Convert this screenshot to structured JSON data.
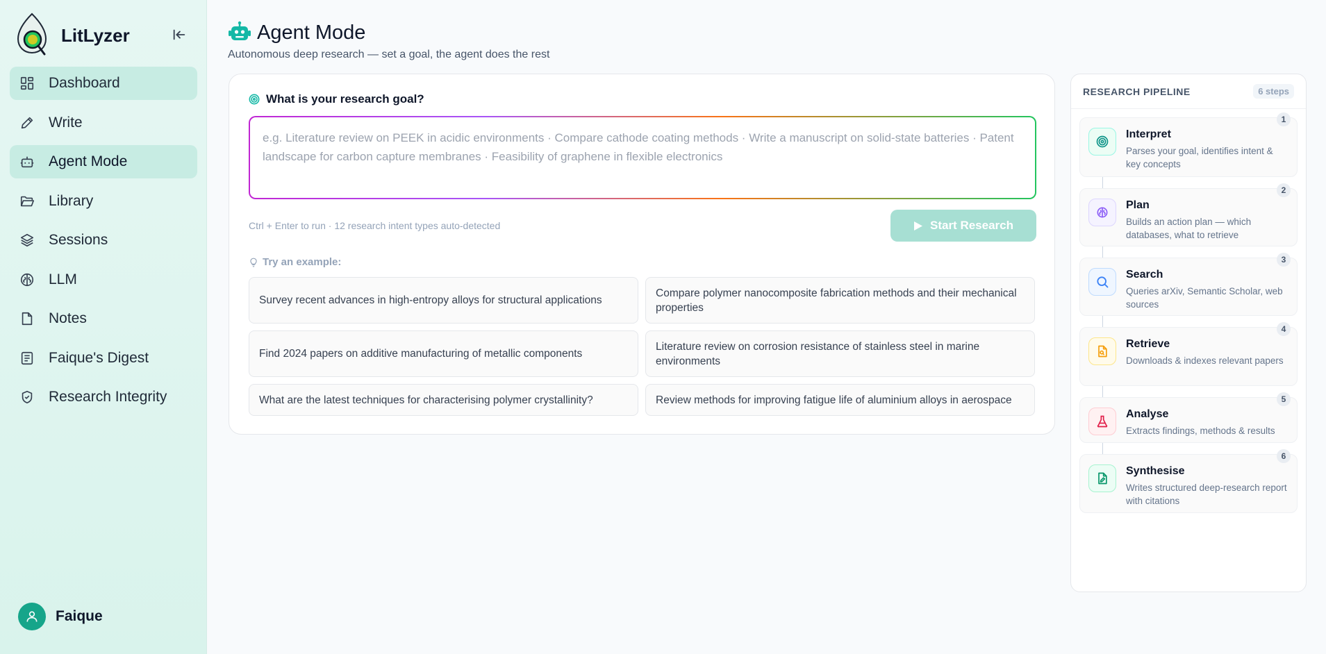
{
  "app": {
    "name": "LitLyzer"
  },
  "sidebar": {
    "items": [
      {
        "label": "Dashboard",
        "icon": "dashboard-icon"
      },
      {
        "label": "Write",
        "icon": "pencil-icon"
      },
      {
        "label": "Agent Mode",
        "icon": "bot-icon"
      },
      {
        "label": "Library",
        "icon": "folder-icon"
      },
      {
        "label": "Sessions",
        "icon": "layers-icon"
      },
      {
        "label": "LLM",
        "icon": "brain-icon"
      },
      {
        "label": "Notes",
        "icon": "note-icon"
      },
      {
        "label": "Faique's Digest",
        "icon": "newspaper-icon"
      },
      {
        "label": "Research Integrity",
        "icon": "shield-check-icon"
      }
    ],
    "active": "Agent Mode",
    "user": {
      "name": "Faique"
    }
  },
  "header": {
    "title": "Agent Mode",
    "subtitle": "Autonomous deep research — set a goal, the agent does the rest"
  },
  "goal": {
    "label": "What is your research goal?",
    "value": "",
    "placeholder": "e.g. Literature review on PEEK in acidic environments · Compare cathode coating methods · Write a manuscript on solid-state batteries · Patent landscape for carbon capture membranes · Feasibility of graphene in flexible electronics",
    "hint": "Ctrl + Enter to run · 12 research intent types auto-detected",
    "start_label": "Start Research",
    "examples_label": "Try an example:",
    "examples": [
      "Survey recent advances in high-entropy alloys for structural applications",
      "Compare polymer nanocomposite fabrication methods and their mechanical properties",
      "Find 2024 papers on additive manufacturing of metallic components",
      "Literature review on corrosion resistance of stainless steel in marine environments",
      "What are the latest techniques for characterising polymer crystallinity?",
      "Review methods for improving fatigue life of aluminium alloys in aerospace"
    ]
  },
  "pipeline": {
    "title": "RESEARCH PIPELINE",
    "count": "6 steps",
    "steps": [
      {
        "num": "1",
        "name": "Interpret",
        "desc": "Parses your goal, identifies intent & key concepts",
        "icon": "target-icon",
        "color": "#0d9488"
      },
      {
        "num": "2",
        "name": "Plan",
        "desc": "Builds an action plan — which databases, what to retrieve",
        "icon": "brain-icon",
        "color": "#8b5cf6"
      },
      {
        "num": "3",
        "name": "Search",
        "desc": "Queries arXiv, Semantic Scholar, web sources",
        "icon": "search-icon",
        "color": "#3b82f6"
      },
      {
        "num": "4",
        "name": "Retrieve",
        "desc": "Downloads & indexes relevant papers",
        "icon": "file-search-icon",
        "color": "#f59e0b"
      },
      {
        "num": "5",
        "name": "Analyse",
        "desc": "Extracts findings, methods & results",
        "icon": "flask-icon",
        "color": "#e11d48"
      },
      {
        "num": "6",
        "name": "Synthesise",
        "desc": "Writes structured deep-research report with citations",
        "icon": "file-pen-icon",
        "color": "#059669"
      }
    ]
  }
}
